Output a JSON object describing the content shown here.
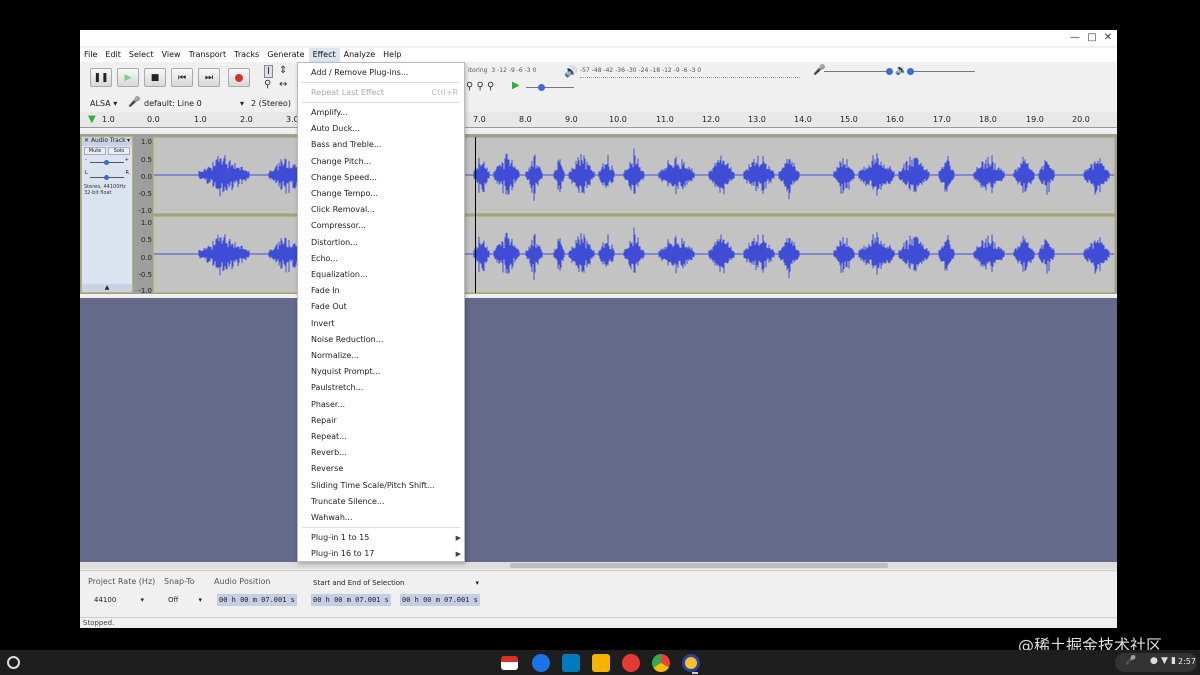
{
  "window": {
    "controls": [
      "—",
      "□",
      "✕"
    ]
  },
  "menubar": [
    "File",
    "Edit",
    "Select",
    "View",
    "Transport",
    "Tracks",
    "Generate",
    "Effect",
    "Analyze",
    "Help"
  ],
  "toolbar": {
    "host": "ALSA",
    "input_device": "default: Line 0",
    "channels": "2 (Stereo)",
    "meter_record_label": "itoring",
    "meter_record_scale": "3 -12 -9 -6 -3 0",
    "meter_play_scale": "-57 -48 -42 -36 -30 -24 -18 -12 -9 -6 -3 0"
  },
  "ruler": [
    "1.0",
    "0.0",
    "1.0",
    "2.0",
    "3.0",
    "7.0",
    "8.0",
    "9.0",
    "10.0",
    "11.0",
    "12.0",
    "13.0",
    "14.0",
    "15.0",
    "16.0",
    "17.0",
    "18.0",
    "19.0",
    "20.0"
  ],
  "track": {
    "name": "Audio Track",
    "mute": "Mute",
    "solo": "Solo",
    "gain_minus": "-",
    "gain_plus": "+",
    "pan_left": "L",
    "pan_right": "R",
    "info_line1": "Stereo, 44100Hz",
    "info_line2": "32-bit float",
    "amplitudes": [
      "1.0",
      "0.5",
      "0.0",
      "-0.5",
      "-1.0",
      "1.0",
      "0.5",
      "0.0",
      "-0.5",
      "-1.0"
    ]
  },
  "effect_menu": {
    "top": [
      {
        "label": "Add / Remove Plug-ins...",
        "enabled": true
      },
      {
        "label": "Repeat Last Effect",
        "shortcut": "Ctrl+R",
        "enabled": false
      }
    ],
    "effects": [
      "Amplify...",
      "Auto Duck...",
      "Bass and Treble...",
      "Change Pitch...",
      "Change Speed...",
      "Change Tempo...",
      "Click Removal...",
      "Compressor...",
      "Distortion...",
      "Echo...",
      "Equalization...",
      "Fade In",
      "Fade Out",
      "Invert",
      "Noise Reduction...",
      "Normalize...",
      "Nyquist Prompt...",
      "Paulstretch...",
      "Phaser...",
      "Repair",
      "Repeat...",
      "Reverb...",
      "Reverse",
      "Sliding Time Scale/Pitch Shift...",
      "Truncate Silence...",
      "Wahwah..."
    ],
    "submenus": [
      "Plug-in 1 to 15",
      "Plug-in 16 to 17"
    ]
  },
  "selection_toolbar": {
    "rate_label": "Project Rate (Hz)",
    "rate_value": "44100",
    "snap_label": "Snap-To",
    "snap_value": "Off",
    "position_label": "Audio Position",
    "position_value": "00 h 00 m 07.001 s",
    "selection_mode": "Start and End of Selection",
    "start_value": "00 h 00 m 07.001 s",
    "end_value": "00 h 00 m 07.001 s"
  },
  "status": "Stopped.",
  "shelf": {
    "time": "2:57"
  },
  "watermark": "@稀土掘金技术社区",
  "colors": {
    "waveform": "#3f4dd6",
    "background_empty": "#65698a",
    "record": "#d9302c",
    "play": "#2fae36"
  }
}
